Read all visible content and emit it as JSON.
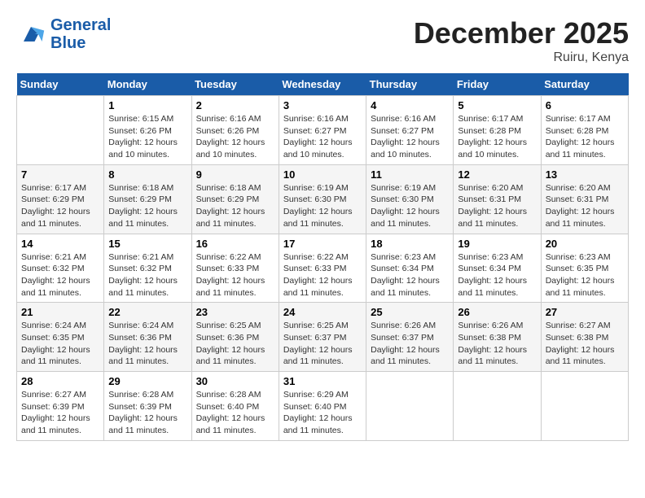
{
  "header": {
    "logo_line1": "General",
    "logo_line2": "Blue",
    "month": "December 2025",
    "location": "Ruiru, Kenya"
  },
  "days_of_week": [
    "Sunday",
    "Monday",
    "Tuesday",
    "Wednesday",
    "Thursday",
    "Friday",
    "Saturday"
  ],
  "weeks": [
    [
      {
        "day": "",
        "sunrise": "",
        "sunset": "",
        "daylight": ""
      },
      {
        "day": "1",
        "sunrise": "Sunrise: 6:15 AM",
        "sunset": "Sunset: 6:26 PM",
        "daylight": "Daylight: 12 hours and 10 minutes."
      },
      {
        "day": "2",
        "sunrise": "Sunrise: 6:16 AM",
        "sunset": "Sunset: 6:26 PM",
        "daylight": "Daylight: 12 hours and 10 minutes."
      },
      {
        "day": "3",
        "sunrise": "Sunrise: 6:16 AM",
        "sunset": "Sunset: 6:27 PM",
        "daylight": "Daylight: 12 hours and 10 minutes."
      },
      {
        "day": "4",
        "sunrise": "Sunrise: 6:16 AM",
        "sunset": "Sunset: 6:27 PM",
        "daylight": "Daylight: 12 hours and 10 minutes."
      },
      {
        "day": "5",
        "sunrise": "Sunrise: 6:17 AM",
        "sunset": "Sunset: 6:28 PM",
        "daylight": "Daylight: 12 hours and 10 minutes."
      },
      {
        "day": "6",
        "sunrise": "Sunrise: 6:17 AM",
        "sunset": "Sunset: 6:28 PM",
        "daylight": "Daylight: 12 hours and 11 minutes."
      }
    ],
    [
      {
        "day": "7",
        "sunrise": "Sunrise: 6:17 AM",
        "sunset": "Sunset: 6:29 PM",
        "daylight": "Daylight: 12 hours and 11 minutes."
      },
      {
        "day": "8",
        "sunrise": "Sunrise: 6:18 AM",
        "sunset": "Sunset: 6:29 PM",
        "daylight": "Daylight: 12 hours and 11 minutes."
      },
      {
        "day": "9",
        "sunrise": "Sunrise: 6:18 AM",
        "sunset": "Sunset: 6:29 PM",
        "daylight": "Daylight: 12 hours and 11 minutes."
      },
      {
        "day": "10",
        "sunrise": "Sunrise: 6:19 AM",
        "sunset": "Sunset: 6:30 PM",
        "daylight": "Daylight: 12 hours and 11 minutes."
      },
      {
        "day": "11",
        "sunrise": "Sunrise: 6:19 AM",
        "sunset": "Sunset: 6:30 PM",
        "daylight": "Daylight: 12 hours and 11 minutes."
      },
      {
        "day": "12",
        "sunrise": "Sunrise: 6:20 AM",
        "sunset": "Sunset: 6:31 PM",
        "daylight": "Daylight: 12 hours and 11 minutes."
      },
      {
        "day": "13",
        "sunrise": "Sunrise: 6:20 AM",
        "sunset": "Sunset: 6:31 PM",
        "daylight": "Daylight: 12 hours and 11 minutes."
      }
    ],
    [
      {
        "day": "14",
        "sunrise": "Sunrise: 6:21 AM",
        "sunset": "Sunset: 6:32 PM",
        "daylight": "Daylight: 12 hours and 11 minutes."
      },
      {
        "day": "15",
        "sunrise": "Sunrise: 6:21 AM",
        "sunset": "Sunset: 6:32 PM",
        "daylight": "Daylight: 12 hours and 11 minutes."
      },
      {
        "day": "16",
        "sunrise": "Sunrise: 6:22 AM",
        "sunset": "Sunset: 6:33 PM",
        "daylight": "Daylight: 12 hours and 11 minutes."
      },
      {
        "day": "17",
        "sunrise": "Sunrise: 6:22 AM",
        "sunset": "Sunset: 6:33 PM",
        "daylight": "Daylight: 12 hours and 11 minutes."
      },
      {
        "day": "18",
        "sunrise": "Sunrise: 6:23 AM",
        "sunset": "Sunset: 6:34 PM",
        "daylight": "Daylight: 12 hours and 11 minutes."
      },
      {
        "day": "19",
        "sunrise": "Sunrise: 6:23 AM",
        "sunset": "Sunset: 6:34 PM",
        "daylight": "Daylight: 12 hours and 11 minutes."
      },
      {
        "day": "20",
        "sunrise": "Sunrise: 6:23 AM",
        "sunset": "Sunset: 6:35 PM",
        "daylight": "Daylight: 12 hours and 11 minutes."
      }
    ],
    [
      {
        "day": "21",
        "sunrise": "Sunrise: 6:24 AM",
        "sunset": "Sunset: 6:35 PM",
        "daylight": "Daylight: 12 hours and 11 minutes."
      },
      {
        "day": "22",
        "sunrise": "Sunrise: 6:24 AM",
        "sunset": "Sunset: 6:36 PM",
        "daylight": "Daylight: 12 hours and 11 minutes."
      },
      {
        "day": "23",
        "sunrise": "Sunrise: 6:25 AM",
        "sunset": "Sunset: 6:36 PM",
        "daylight": "Daylight: 12 hours and 11 minutes."
      },
      {
        "day": "24",
        "sunrise": "Sunrise: 6:25 AM",
        "sunset": "Sunset: 6:37 PM",
        "daylight": "Daylight: 12 hours and 11 minutes."
      },
      {
        "day": "25",
        "sunrise": "Sunrise: 6:26 AM",
        "sunset": "Sunset: 6:37 PM",
        "daylight": "Daylight: 12 hours and 11 minutes."
      },
      {
        "day": "26",
        "sunrise": "Sunrise: 6:26 AM",
        "sunset": "Sunset: 6:38 PM",
        "daylight": "Daylight: 12 hours and 11 minutes."
      },
      {
        "day": "27",
        "sunrise": "Sunrise: 6:27 AM",
        "sunset": "Sunset: 6:38 PM",
        "daylight": "Daylight: 12 hours and 11 minutes."
      }
    ],
    [
      {
        "day": "28",
        "sunrise": "Sunrise: 6:27 AM",
        "sunset": "Sunset: 6:39 PM",
        "daylight": "Daylight: 12 hours and 11 minutes."
      },
      {
        "day": "29",
        "sunrise": "Sunrise: 6:28 AM",
        "sunset": "Sunset: 6:39 PM",
        "daylight": "Daylight: 12 hours and 11 minutes."
      },
      {
        "day": "30",
        "sunrise": "Sunrise: 6:28 AM",
        "sunset": "Sunset: 6:40 PM",
        "daylight": "Daylight: 12 hours and 11 minutes."
      },
      {
        "day": "31",
        "sunrise": "Sunrise: 6:29 AM",
        "sunset": "Sunset: 6:40 PM",
        "daylight": "Daylight: 12 hours and 11 minutes."
      },
      {
        "day": "",
        "sunrise": "",
        "sunset": "",
        "daylight": ""
      },
      {
        "day": "",
        "sunrise": "",
        "sunset": "",
        "daylight": ""
      },
      {
        "day": "",
        "sunrise": "",
        "sunset": "",
        "daylight": ""
      }
    ]
  ]
}
